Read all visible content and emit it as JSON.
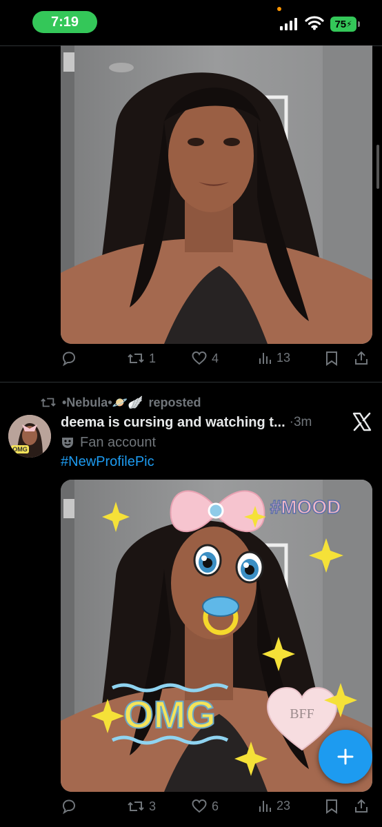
{
  "status_bar": {
    "time": "7:19",
    "battery": "75",
    "colors": {
      "time_pill": "#34c759",
      "battery": "#34c759",
      "privacy_dot": "#ff9500"
    }
  },
  "post1": {
    "image": {
      "alt_icon": "photo-woman-selfie"
    },
    "actions": {
      "reply": "",
      "reposts": "1",
      "likes": "4",
      "views": "13"
    }
  },
  "post2": {
    "repost": {
      "reposter": "•Nebula•🪐🪽",
      "label": "reposted"
    },
    "author": {
      "name": "deema is cursing and watching t...",
      "time": "·3m"
    },
    "fan_label": "Fan account",
    "hashtag": "#NewProfilePic",
    "stickers": {
      "mood": "#MOOD",
      "omg": "OMG",
      "bff": "BFF"
    },
    "avatar_text": "OMG",
    "actions": {
      "reply": "",
      "reposts": "3",
      "likes": "6",
      "views": "23"
    }
  },
  "colors": {
    "accent": "#1d9bf0",
    "muted": "#71767b",
    "background": "#000000"
  },
  "fab_icon": "plus-icon"
}
